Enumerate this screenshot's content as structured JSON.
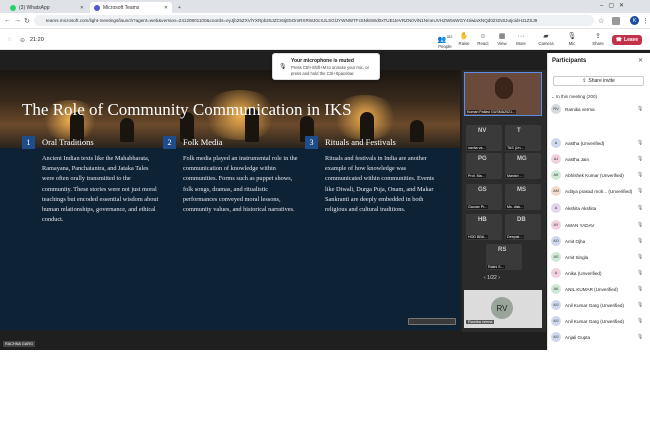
{
  "browser": {
    "tabs": [
      {
        "label": "(3) WhatsApp",
        "icon_color": "#25d366"
      },
      {
        "label": "Microsoft Teams",
        "icon_color": "#5059c9"
      }
    ],
    "url": "teams.microsoft.com/light-meetings/launch?agent=web&version=24120801100&coords=eyJjb25ZXVlYXRpb25JZCI6IjE5OmRXRWJ0cXJLSGlJYWNWTFc5Nk5Wd0xTUEtJeVRZN0ViN1NmeUVHZW5sWGY4IiwiaXNQd0ZGN0JuIjoidHJ1ZSJ9",
    "profile_initial": "K"
  },
  "meeting": {
    "timer": "21:20",
    "tools": [
      {
        "label": "People",
        "count": "283"
      },
      {
        "label": "Raise"
      },
      {
        "label": "React"
      },
      {
        "label": "View"
      },
      {
        "label": "More"
      },
      {
        "label": "Camera"
      },
      {
        "label": "Mic"
      },
      {
        "label": "Share"
      }
    ],
    "leave_label": "Leave"
  },
  "toast": {
    "title": "Your microphone is muted",
    "body": "Press Ctrl+Shift+M to unmute your mic, or press and hold the Ctrl+Spacebar."
  },
  "slide": {
    "title": "The Role of Community Communication in IKS",
    "columns": [
      {
        "num": "1",
        "heading": "Oral Traditions",
        "body": "Ancient Indian texts like the Mahabharata, Ramayana, Panchatantra, and Jataka Tales were often orally transmitted to the community. These stories were not just moral teachings but encoded essential wisdom about human relationships, governance, and ethical conduct."
      },
      {
        "num": "2",
        "heading": "Folk Media",
        "body": "Folk media played an instrumental role in the communication of knowledge within communities. Forms such as puppet shows, folk songs, dramas, and ritualistic performances conveyed moral lessons, community values, and historical narratives."
      },
      {
        "num": "3",
        "heading": "Rituals and Festivals",
        "body": "Rituals and festivals in India are another example of how knowledge was communicated within communities. Events like Diwali, Durga Puja, Onam, and Makar Sankranti are deeply embedded in both religious and cultural traditions."
      }
    ]
  },
  "video": {
    "self_name": "Kumari Pallavi GUSMA2021...",
    "tiles": [
      {
        "initials": "NV",
        "name": "navita va..."
      },
      {
        "initials": "T",
        "name": "TAS (Un..."
      },
      {
        "initials": "PG",
        "name": "Prof. Ma..."
      },
      {
        "initials": "MG",
        "name": "Manish ..."
      },
      {
        "initials": "GS",
        "name": "Gaurav Pr..."
      },
      {
        "initials": "MS",
        "name": "Ms. disk..."
      },
      {
        "initials": "HB",
        "name": "HOD BBA..."
      },
      {
        "initials": "DB",
        "name": "Deepak ..."
      },
      {
        "initials": "RS",
        "name": "Rakhi S..."
      }
    ],
    "pager": "1/22",
    "bottom_tile": {
      "initials": "RV",
      "name": "Ramika verma"
    },
    "stage_name": "RACHNA GARG"
  },
  "participants": {
    "title": "Participants",
    "share_invite": "Share invite",
    "in_meeting": "In this meeting (200)",
    "list": [
      {
        "initials": "RV",
        "name": "Ramika verma",
        "color": "#d6d9de"
      },
      {
        "initials": "A",
        "name": "Aastha (Unverified)",
        "color": "#cfd8f0"
      },
      {
        "initials": "AJ",
        "name": "Aastha Jain",
        "color": "#f3d0e0"
      },
      {
        "initials": "AK",
        "name": "Abhishek Kumar (Unverified)",
        "color": "#cfe8d8"
      },
      {
        "initials": "AM",
        "name": "Aditya prasad moh... (Unverified)",
        "color": "#f0dccd"
      },
      {
        "initials": "A",
        "name": "Akshita Akshita",
        "color": "#e5d6f0"
      },
      {
        "initials": "AY",
        "name": "AMAN YADAV",
        "color": "#f3d0e0"
      },
      {
        "initials": "AO",
        "name": "Amit Ojha",
        "color": "#cfd8f0"
      },
      {
        "initials": "AS",
        "name": "Amit Singla",
        "color": "#cfe8d8"
      },
      {
        "initials": "A",
        "name": "Anika (Unverified)",
        "color": "#f3d0e0"
      },
      {
        "initials": "AK",
        "name": "ANIL KUMAR (Unverified)",
        "color": "#cfe8d8"
      },
      {
        "initials": "AG",
        "name": "Anil Kumar Garg (Unverified)",
        "color": "#cfd8f0"
      },
      {
        "initials": "AG",
        "name": "Anil Kumar Garg (Unverified)",
        "color": "#cfd8f0"
      },
      {
        "initials": "AG",
        "name": "Anjali Gupta",
        "color": "#cfd8f0"
      }
    ]
  }
}
